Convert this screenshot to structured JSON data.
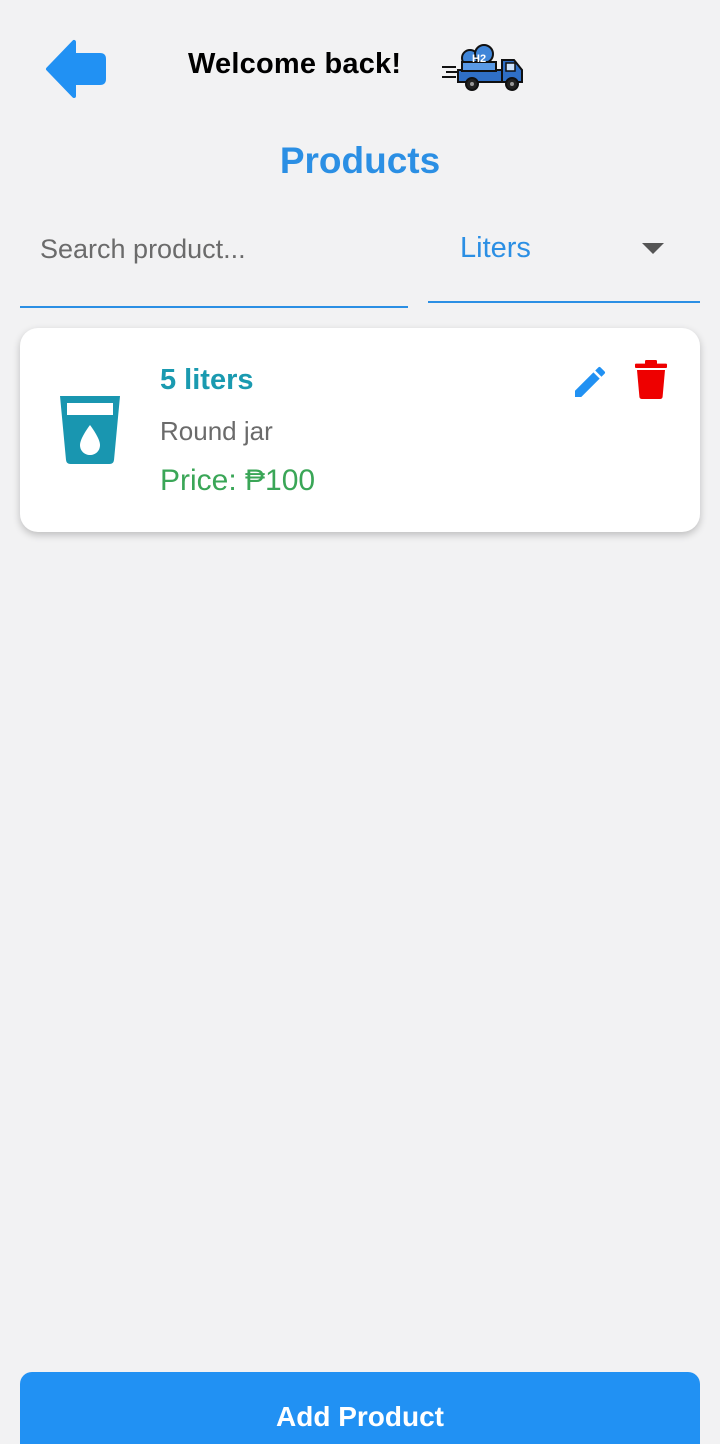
{
  "header": {
    "welcome_text": "Welcome back!",
    "back_icon": "arrow-left-icon",
    "logo_icon": "delivery-truck-logo"
  },
  "page": {
    "title": "Products"
  },
  "search": {
    "placeholder": "Search product...",
    "value": ""
  },
  "filter": {
    "selected": "Liters",
    "icon": "chevron-down-icon"
  },
  "products": [
    {
      "name": "5 liters",
      "description": "Round jar",
      "price_text": "Price: ₱100",
      "icon": "water-glass-icon"
    }
  ],
  "footer": {
    "add_label": "Add Product"
  },
  "colors": {
    "accent": "#2b8fe4",
    "button": "#2191f3",
    "product_name": "#1a9ab0",
    "price": "#3aa657",
    "delete": "#ee0000",
    "background": "#f2f2f3"
  }
}
